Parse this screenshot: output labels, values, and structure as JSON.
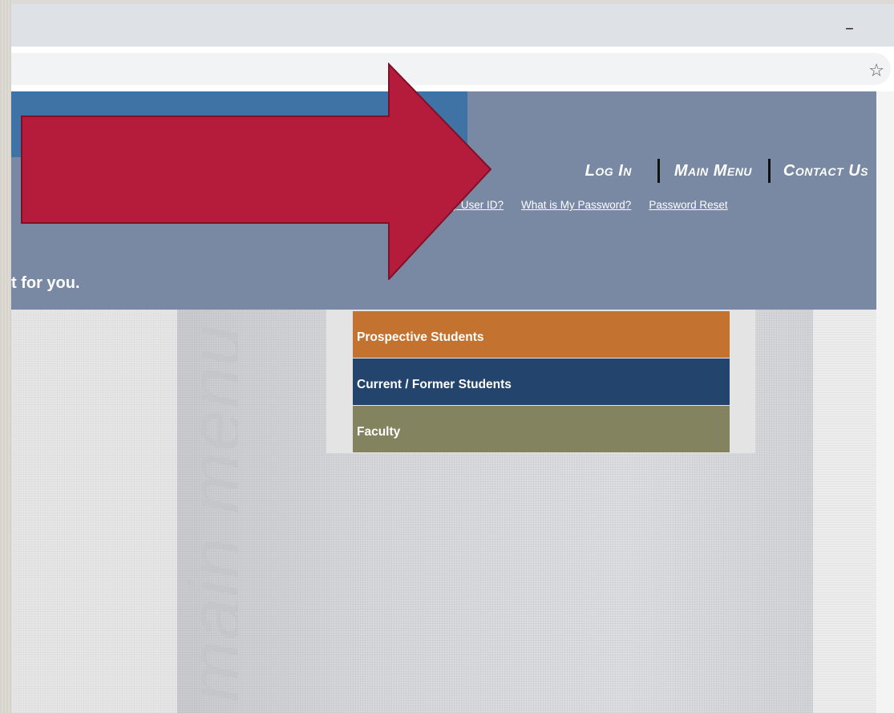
{
  "browser": {
    "minimize_glyph": "–",
    "bookmark_icon": "star-icon",
    "bookmark_glyph": "☆"
  },
  "header": {
    "nav": {
      "login": "Log In",
      "main_menu": "Main Menu",
      "contact_us": "Contact Us"
    },
    "sub_links": {
      "user_id": "hat is My User ID?",
      "password": "What is My Password?",
      "reset": "Password Reset"
    },
    "tagline": "t for you."
  },
  "watermark_text": "main menu",
  "menu": {
    "items": [
      {
        "label": "Prospective Students",
        "color": "#c3732f"
      },
      {
        "label": "Current / Former Students",
        "color": "#22446d"
      },
      {
        "label": "Faculty",
        "color": "#838360"
      }
    ]
  },
  "annotation": {
    "type": "arrow-icon",
    "color": "#b51c3c"
  }
}
